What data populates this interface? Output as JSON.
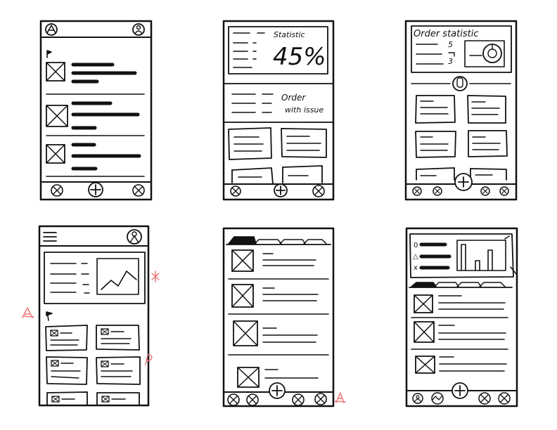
{
  "sketch": {
    "ink_color": "#111111",
    "marker_color": "#ee7777",
    "screens": [
      {
        "id": "screen-1",
        "label_text": []
      },
      {
        "id": "screen-2",
        "stat_title": "Statistic",
        "stat_value": "45%",
        "order_title_line1": "Order",
        "order_title_line2": "with issue"
      },
      {
        "id": "screen-3",
        "order_stat_title": "Order statistic",
        "count_a": "5",
        "count_b": "3"
      },
      {
        "id": "screen-4"
      },
      {
        "id": "screen-5"
      },
      {
        "id": "screen-6",
        "legend_markers": [
          "0",
          "△",
          "x"
        ]
      }
    ]
  }
}
